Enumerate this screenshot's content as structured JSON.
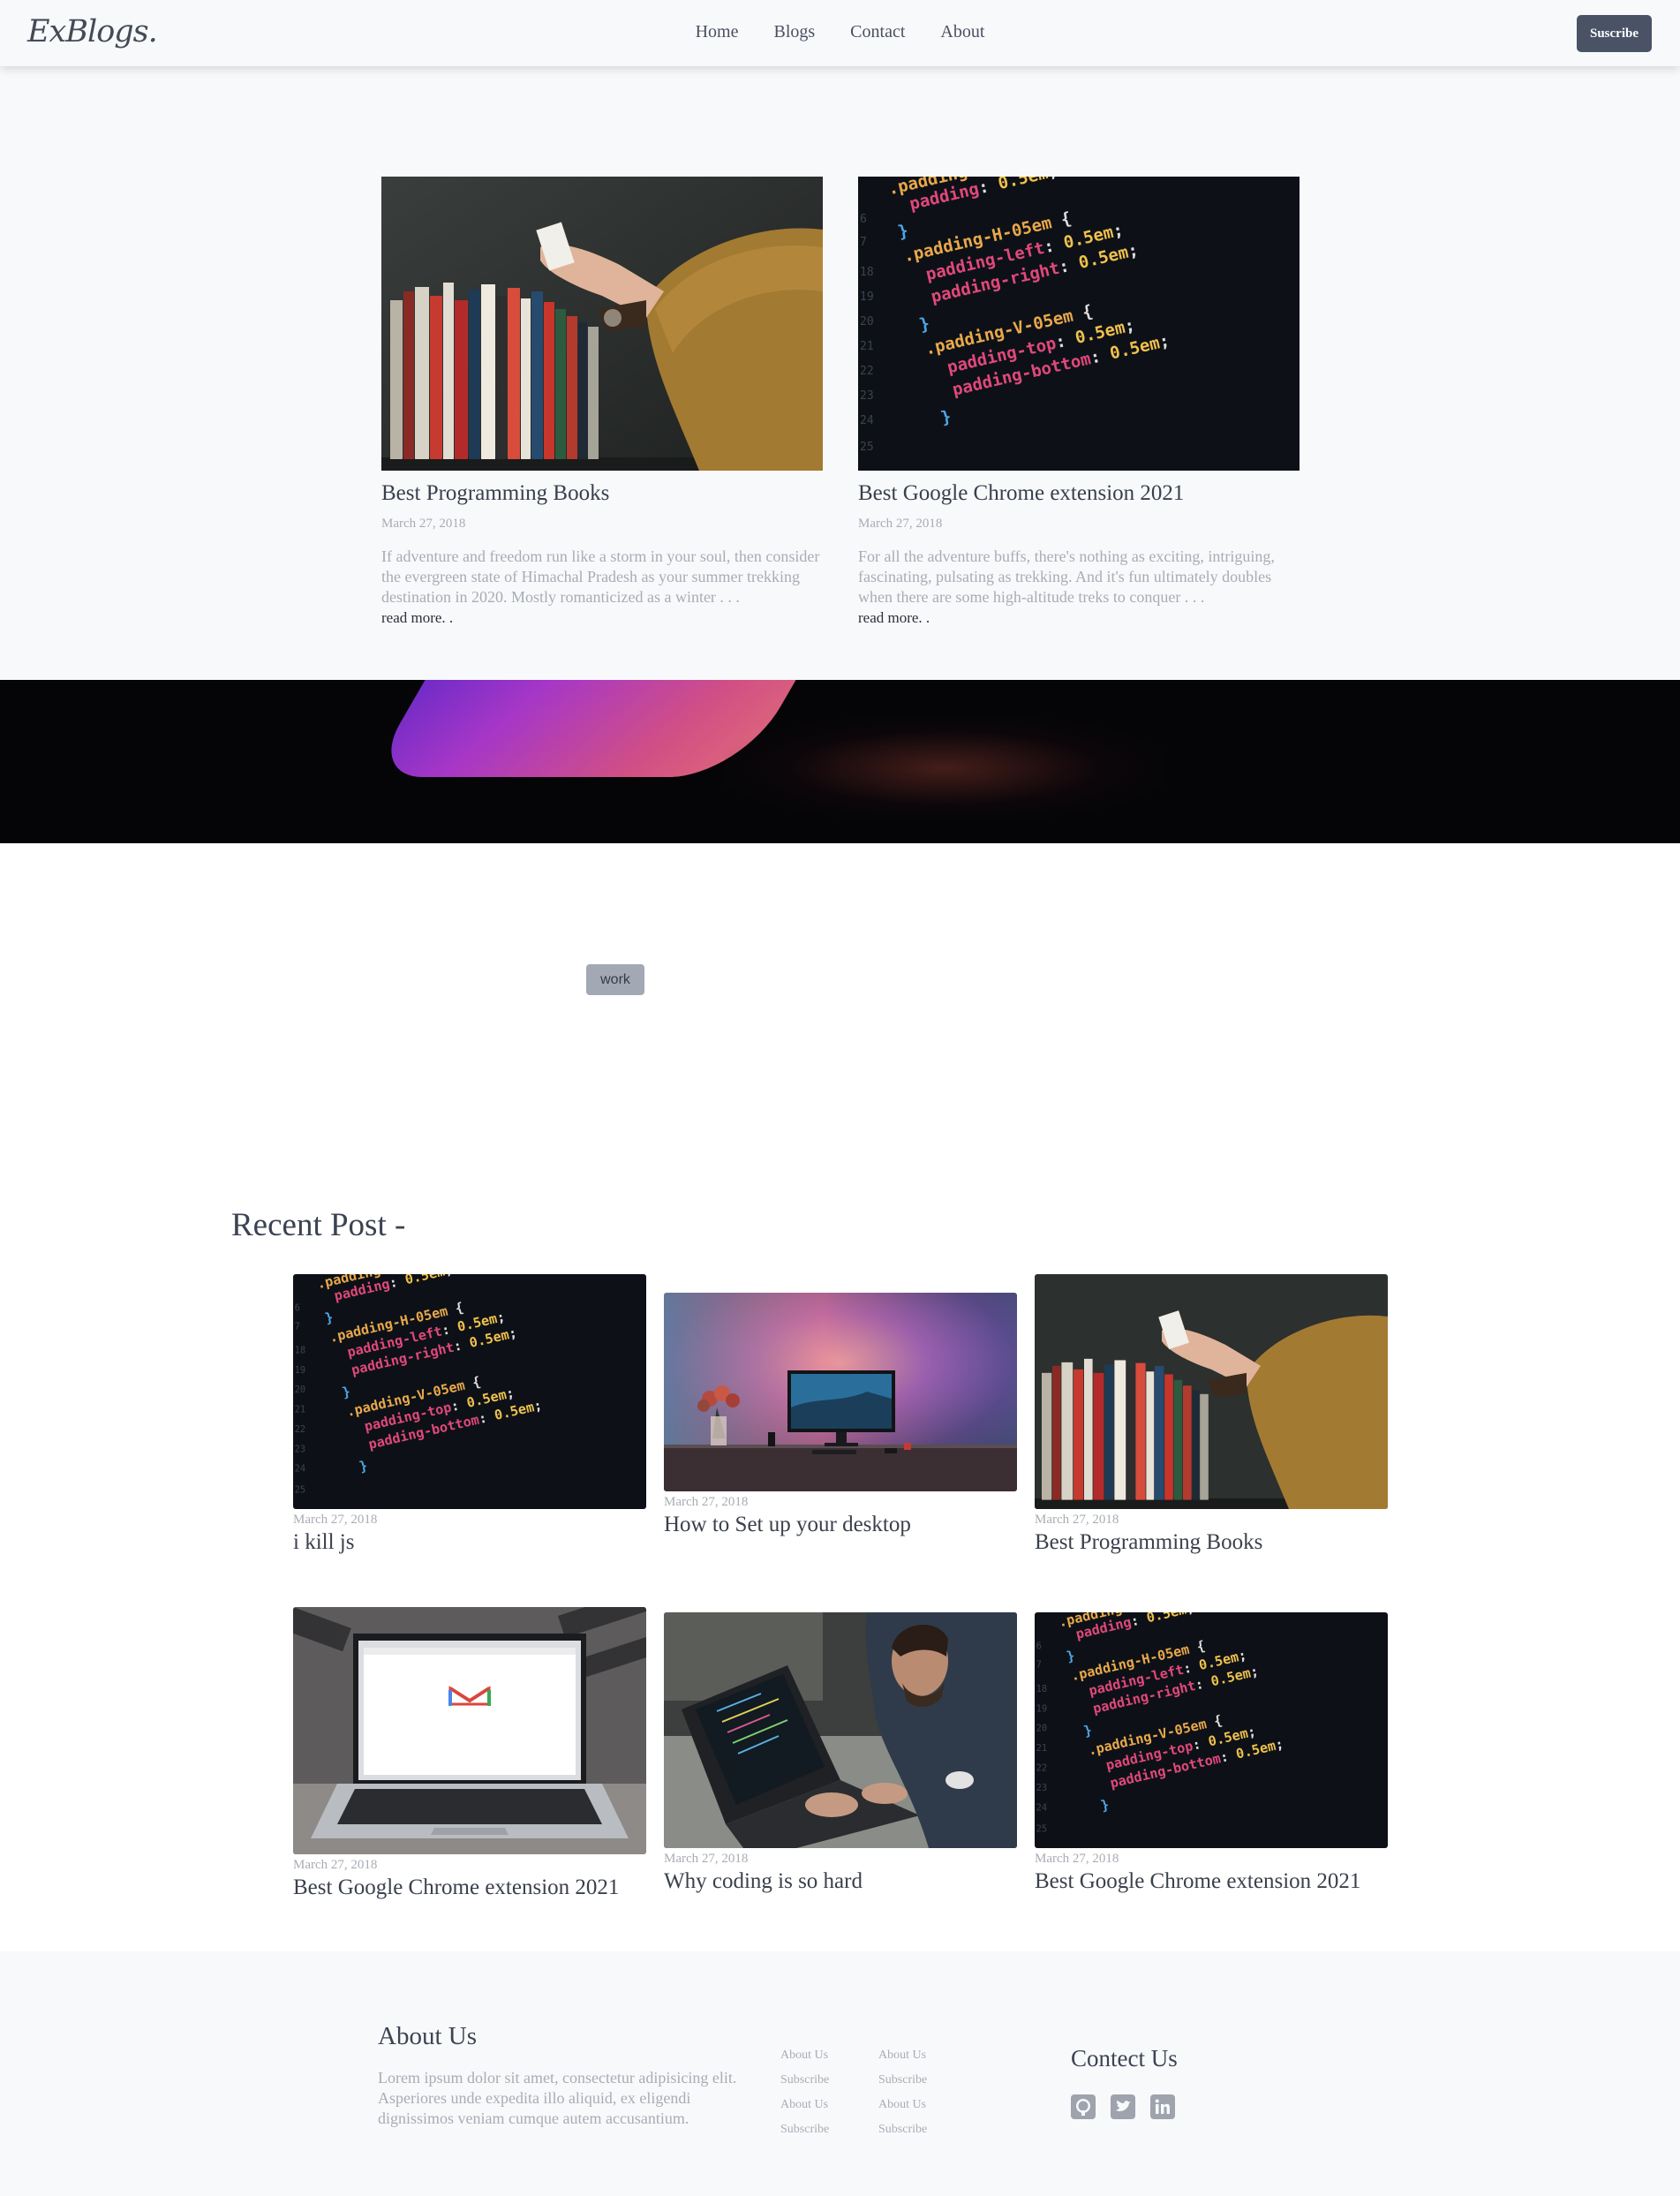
{
  "header": {
    "logo": "ExBlogs.",
    "nav": [
      "Home",
      "Blogs",
      "Contact",
      "About"
    ],
    "subscribe": "Suscribe"
  },
  "featured": [
    {
      "image": "bookshelf-photo",
      "title": "Best Programming Books",
      "date": "March 27, 2018",
      "excerpt": "If adventure and freedom run like a storm in your soul, then consider the evergreen state of Himachal Pradesh as your summer trekking destination in 2020. Mostly romanticized as a winter . . .",
      "more": "read more. ."
    },
    {
      "image": "css-code-photo",
      "title": "Best Google Chrome extension 2021",
      "date": "March 27, 2018",
      "excerpt": "For all the adventure buffs, there's nothing as exciting, intriguing, fascinating, pulsating as trekking. And it's fun ultimately doubles when there are some high-altitude treks to conquer . . .",
      "more": "read more. ."
    }
  ],
  "tag": "work",
  "recent": {
    "heading": "Recent Post -",
    "posts": [
      {
        "image": "css-code-photo",
        "date": "March 27, 2018",
        "title": "i kill js"
      },
      {
        "image": "desk-setup-photo",
        "date": "March 27, 2018",
        "title": "How to Set up your desktop"
      },
      {
        "image": "bookshelf-photo",
        "date": "March 27, 2018",
        "title": "Best Programming Books"
      },
      {
        "image": "gmail-laptop-photo",
        "date": "March 27, 2018",
        "title": "Best Google Chrome extension 2021"
      },
      {
        "image": "man-coding-photo",
        "date": "March 27, 2018",
        "title": "Why coding is so hard"
      },
      {
        "image": "css-code-photo",
        "date": "March 27, 2018",
        "title": "Best Google Chrome extension 2021"
      }
    ]
  },
  "code_snippet": [
    ".padding",
    "  padding: 0.5em;",
    "}",
    ".padding-H-05em {",
    "  padding-left: 0.5em;",
    "  padding-right: 0.5em;",
    "}",
    ".padding-V-05em {",
    "  padding-top: 0.5em;",
    "  padding-bottom: 0.5em;",
    "}"
  ],
  "footer": {
    "about_heading": "About Us",
    "about_text": "Lorem ipsum dolor sit amet, consectetur adipisicing elit. Asperiores unde expedita illo aliquid, ex eligendi dignissimos veniam cumque autem accusantium.",
    "links_col1": [
      "About Us",
      "Subscribe",
      "About Us",
      "Subscribe"
    ],
    "links_col2": [
      "About Us",
      "Subscribe",
      "About Us",
      "Subscribe"
    ],
    "contact_heading": "Contect Us",
    "social": [
      "github-icon",
      "twitter-icon",
      "linkedin-icon"
    ]
  },
  "colors": {
    "header_bg": "#f8f9fb",
    "button": "#4a5266",
    "text_dark": "#39404d",
    "text_muted": "#a8acb4",
    "tag_bg": "#a3a8b5"
  }
}
